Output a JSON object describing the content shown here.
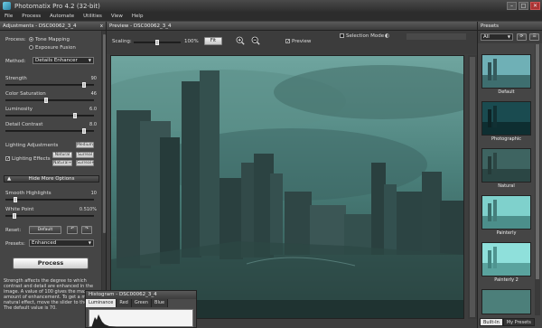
{
  "window": {
    "title": "Photomatix Pro 4.2 (32-bit)",
    "minimize": "–",
    "maximize": "□",
    "close": "✕"
  },
  "menu": [
    "File",
    "Process",
    "Automate",
    "Utilities",
    "View",
    "Help"
  ],
  "adjustments": {
    "header": "Adjustments - DSC00062_3_4",
    "close": "x",
    "process_label": "Process:",
    "process_options": [
      "Tone Mapping",
      "Exposure Fusion"
    ],
    "method_label": "Method:",
    "method_value": "Details Enhancer",
    "sliders": [
      {
        "label": "Strength",
        "value": "90",
        "fraction": 0.9
      },
      {
        "label": "Color Saturation",
        "value": "46",
        "fraction": 0.46
      },
      {
        "label": "Luminosity",
        "value": "6.0",
        "fraction": 0.8
      },
      {
        "label": "Detail Contrast",
        "value": "8.0",
        "fraction": 0.9
      }
    ],
    "lighting_label": "Lighting Adjustments",
    "lighting_buttons": [
      "Medium",
      "Natural",
      "Surreal",
      "Natural+",
      "Surreal+"
    ],
    "lighting_effects_label": "Lighting Effects",
    "hide_more_label": "Hide More Options",
    "extra_sliders": [
      {
        "label": "Smooth Highlights",
        "value": "10",
        "fraction": 0.1
      },
      {
        "label": "White Point",
        "value": "0.510%",
        "fraction": 0.08
      }
    ],
    "reset_label": "Reset:",
    "reset_button": "Default",
    "presets_label": "Presets:",
    "presets_value": "Enhanced",
    "process_button": "Process",
    "description": "Strength affects the degree to which contrast and detail are enhanced in the image. A value of 100 gives the max amount of enhancement. To get a more natural effect, move the slider to the left. The default value is 70."
  },
  "preview": {
    "header": "Preview - DSC00062_3_4",
    "scaling_label": "Scaling:",
    "scaling_value": "100%",
    "fit_button": "Fit",
    "preview_label": "Preview",
    "selection_mode_label": "Selection Mode"
  },
  "presets_panel": {
    "header": "Presets",
    "filter_value": "All",
    "items": [
      "Default",
      "Photographic",
      "Natural",
      "Painterly",
      "Painterly 2"
    ],
    "tabs": [
      "Built-In",
      "My Presets"
    ],
    "active_tab": "Built-In"
  },
  "histogram": {
    "header": "Histogram - DSC00062_3_4",
    "tabs": [
      "Luminance",
      "Red",
      "Green",
      "Blue"
    ],
    "active_tab": "Luminance"
  }
}
